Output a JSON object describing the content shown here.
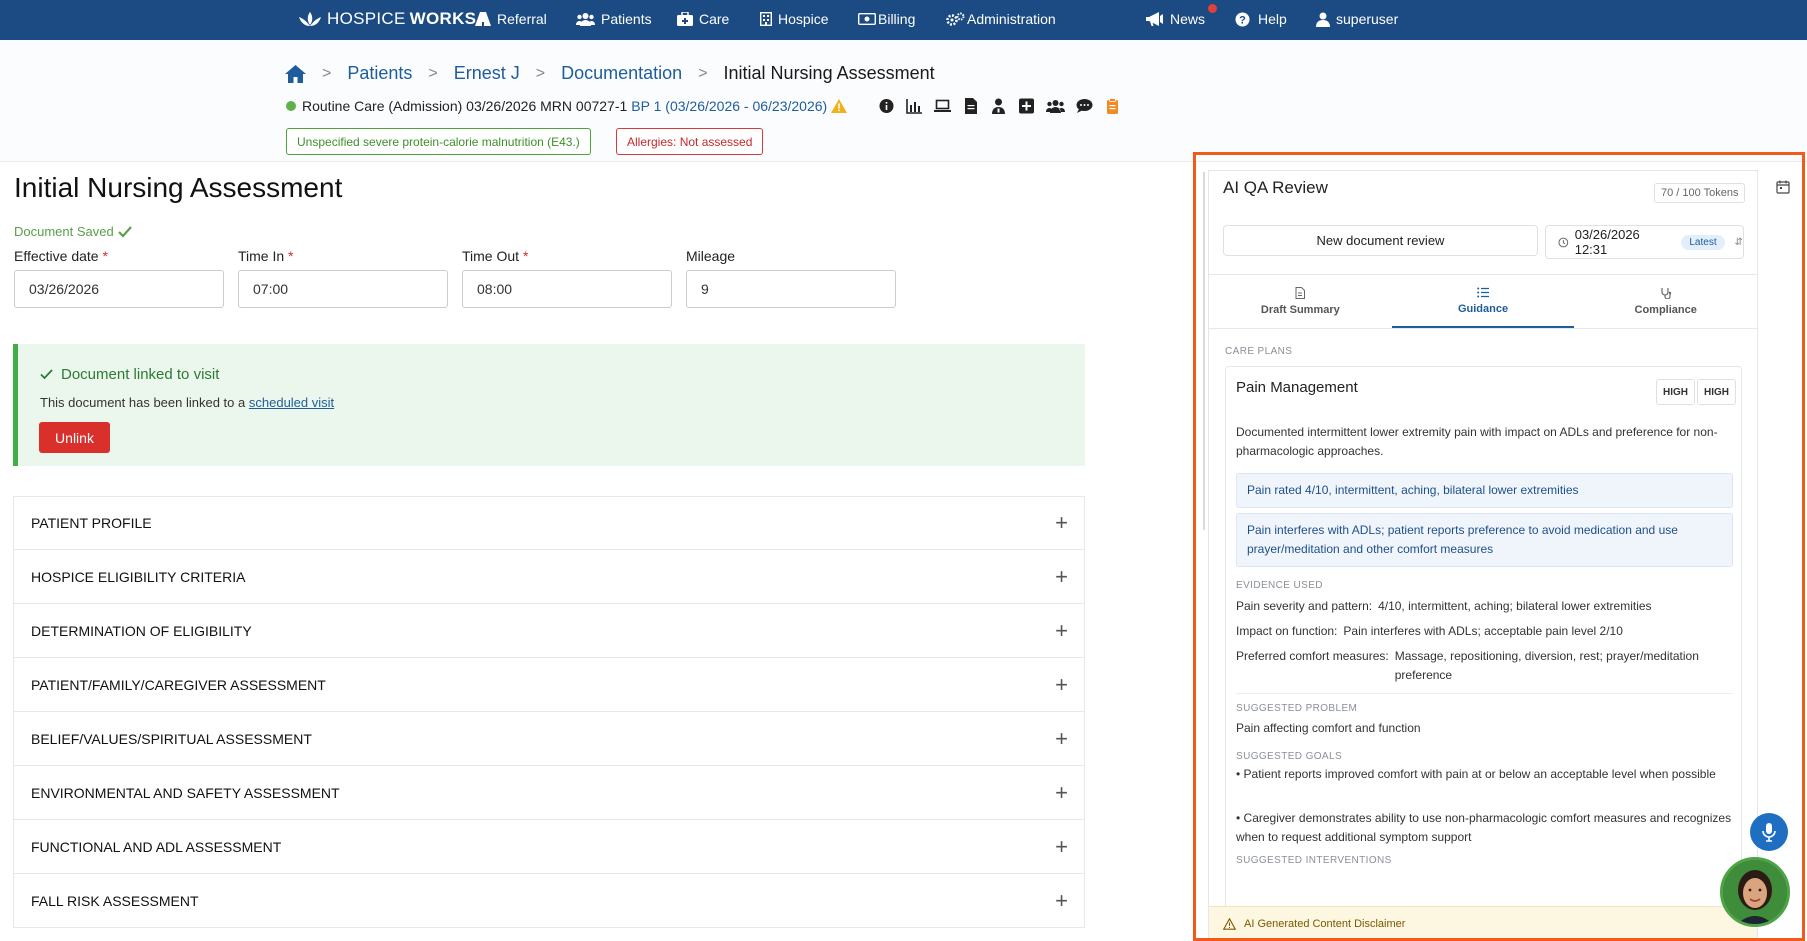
{
  "nav": {
    "brand_light": "HOSPICE",
    "brand_bold": "WORKS",
    "items": [
      {
        "label": "Referral",
        "icon": "road-icon"
      },
      {
        "label": "Patients",
        "icon": "users-icon"
      },
      {
        "label": "Care",
        "icon": "medkit-icon"
      },
      {
        "label": "Hospice",
        "icon": "building-icon"
      },
      {
        "label": "Billing",
        "icon": "money-icon"
      },
      {
        "label": "Administration",
        "icon": "gears-icon"
      }
    ],
    "right": [
      {
        "label": "News",
        "icon": "bullhorn-icon"
      },
      {
        "label": "Help",
        "icon": "question-circle-icon"
      },
      {
        "label": "superuser",
        "icon": "user-icon"
      }
    ]
  },
  "breadcrumb": {
    "items": [
      "Patients",
      "Ernest J",
      "Documentation"
    ],
    "current": "Initial Nursing Assessment"
  },
  "care": {
    "level": "Routine Care",
    "admission": "(Admission) 03/26/2026 MRN 00727-1",
    "bp": "BP 1 (03/26/2026 - 06/23/2026)"
  },
  "tags": {
    "diagnosis": "Unspecified severe protein-calorie malnutrition (E43.)",
    "allergies": "Allergies: Not assessed"
  },
  "page": {
    "title": "Initial Nursing Assessment",
    "saved": "Document Saved"
  },
  "fields": {
    "effective_label": "Effective date",
    "effective_value": "03/26/2026",
    "timein_label": "Time In",
    "timein_value": "07:00",
    "timeout_label": "Time Out",
    "timeout_value": "08:00",
    "mileage_label": "Mileage",
    "mileage_value": "9"
  },
  "linked": {
    "title": "Document linked to visit",
    "desc_prefix": "This document has been linked to a",
    "link": "scheduled visit",
    "button": "Unlink"
  },
  "sections": [
    "PATIENT PROFILE",
    "HOSPICE ELIGIBILITY CRITERIA",
    "DETERMINATION OF ELIGIBILITY",
    "PATIENT/FAMILY/CAREGIVER ASSESSMENT",
    "BELIEF/VALUES/SPIRITUAL ASSESSMENT",
    "ENVIRONMENTAL AND SAFETY ASSESSMENT",
    "FUNCTIONAL AND ADL ASSESSMENT",
    "FALL RISK ASSESSMENT"
  ],
  "qa": {
    "title": "AI QA Review",
    "tokens": "70 / 100 Tokens",
    "new_review": "New document review",
    "date": "03/26/2026 12:31",
    "latest": "Latest",
    "tabs": [
      "Draft Summary",
      "Guidance",
      "Compliance"
    ],
    "active_tab": "Guidance",
    "care_plans_label": "CARE PLANS",
    "plan_title": "Pain Management",
    "badge1": "HIGH",
    "badge2": "HIGH",
    "desc": "Documented intermittent lower extremity pain with impact on ADLs and preference for non-pharmacologic approaches.",
    "chip1": "Pain rated 4/10, intermittent, aching, bilateral lower extremities",
    "chip2": "Pain interferes with ADLs; patient reports preference to avoid medication and use prayer/meditation and other comfort measures",
    "evidence_label": "EVIDENCE USED",
    "ev1_k": "Pain severity and pattern:",
    "ev1_v": "4/10, intermittent, aching; bilateral lower extremities",
    "ev2_k": "Impact on function:",
    "ev2_v": "Pain interferes with ADLs; acceptable pain level 2/10",
    "ev3_k": "Preferred comfort measures:",
    "ev3_v": "Massage, repositioning, diversion, rest; prayer/meditation preference",
    "problem_label": "SUGGESTED PROBLEM",
    "problem": "Pain affecting comfort and function",
    "goals_label": "SUGGESTED GOALS",
    "goal1": "• Patient reports improved comfort with pain at or below an acceptable level when possible",
    "goal2": "• Caregiver demonstrates ability to use non-pharmacologic comfort measures and recognizes when to request additional symptom support",
    "interventions_label": "SUGGESTED INTERVENTIONS",
    "disclaimer": "AI Generated Content Disclaimer"
  },
  "colors": {
    "nav": "#1b4b82",
    "accent": "#1e5d9c",
    "highlight_outline": "#f05a1a",
    "danger": "#d9302b",
    "success": "#3fae47"
  }
}
